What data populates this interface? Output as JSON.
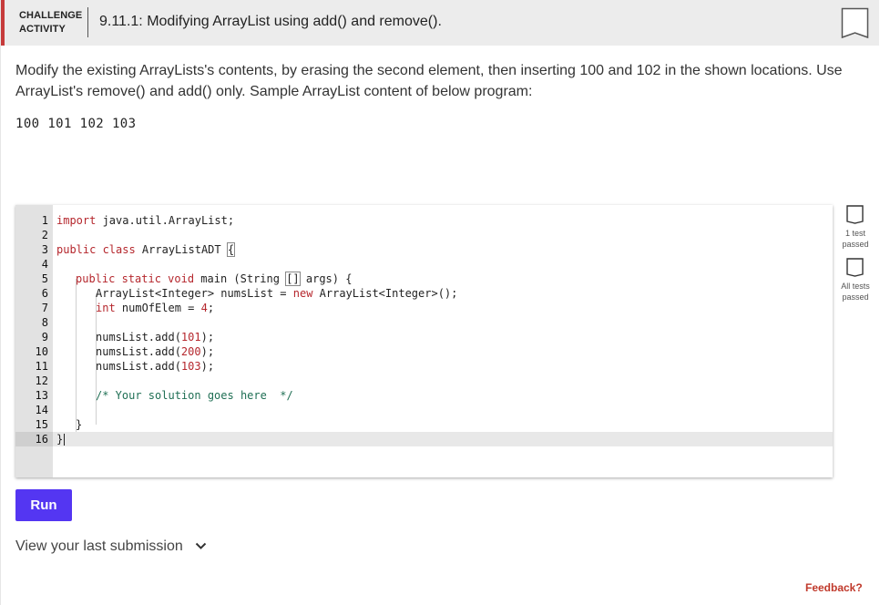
{
  "header": {
    "badge_line1": "CHALLENGE",
    "badge_line2": "ACTIVITY",
    "title": "9.11.1: Modifying ArrayList using add() and remove().",
    "bookmark_icon": "bookmark-icon",
    "accent_color": "#c63b3b"
  },
  "instructions": {
    "text": "Modify the existing ArrayLists's contents, by erasing the second element, then inserting 100 and 102 in the shown locations. Use ArrayList's remove() and add() only. Sample ArrayList content of below program:",
    "sample_output": "100 101 102 103"
  },
  "editor": {
    "line_numbers": [
      "1",
      "2",
      "3",
      "4",
      "5",
      "6",
      "7",
      "8",
      "9",
      "10",
      "11",
      "12",
      "13",
      "14",
      "15",
      "16"
    ],
    "lines": {
      "l1_kw": "import",
      "l1_rest": " java.util.ArrayList;",
      "l3_kw": "public class",
      "l3_name": " ArrayListADT ",
      "l3_brace": "{",
      "l5_kw": "public static void",
      "l5_rest": " main (String ",
      "l5_arr": "[]",
      "l5_end": " args) {",
      "l6_a": "ArrayList<Integer> numsList = ",
      "l6_kw": "new",
      "l6_b": " ArrayList<Integer>();",
      "l7_kw": "int",
      "l7_a": " numOfElem = ",
      "l7_num": "4",
      "l7_b": ";",
      "l9_a": "numsList.add(",
      "l9_num": "101",
      "l9_b": ");",
      "l10_a": "numsList.add(",
      "l10_num": "200",
      "l10_b": ");",
      "l11_a": "numsList.add(",
      "l11_num": "103",
      "l11_b": ");",
      "l13_comment": "/* Your solution goes here  */",
      "l15_brace": "}",
      "l16_brace": "}"
    }
  },
  "tests": {
    "test1_label": "1 test passed",
    "test2_label": "All tests passed",
    "check_icon": "checkbox-icon"
  },
  "actions": {
    "run_label": "Run",
    "view_submission_label": "View your last submission",
    "chevron_icon": "chevron-down-icon",
    "run_color": "#5436f2",
    "feedback_label": "Feedback?",
    "feedback_color": "#c0392b"
  }
}
